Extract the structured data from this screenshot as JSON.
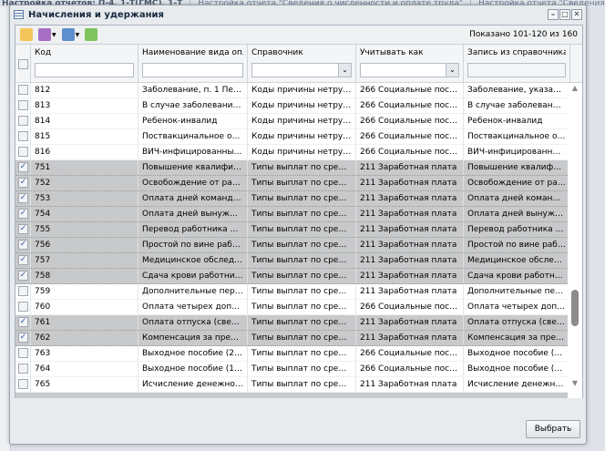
{
  "background_tabs": [
    "Настройка отчетов: П-4, 1-Т(ГМС), 1-Т",
    "Настройка отчета \"Сведения о численности и оплате труда\"",
    "Настройка отчета \"Сведения о распределении ч"
  ],
  "window": {
    "title": "Начисления и удержания",
    "page_info": "Показано 101-120 из 160",
    "select_label": "Выбрать"
  },
  "columns": [
    "Код",
    "Наименование вида опла...",
    "Справочник",
    "Учитывать как",
    "Запись из справочника"
  ],
  "rows": [
    {
      "checked": false,
      "code": "812",
      "name": "Заболевание, п. 1 Переч...",
      "ref": "Коды причины нетрудос...",
      "as": "266 Социальные пособия...",
      "rec": "Заболевание, указанное ..."
    },
    {
      "checked": false,
      "code": "813",
      "name": "В случае заболевания ре...",
      "ref": "Коды причины нетрудос...",
      "as": "266 Социальные пособия...",
      "rec": "В случае заболевания ре..."
    },
    {
      "checked": false,
      "code": "814",
      "name": "Ребенок-инвалид",
      "ref": "Коды причины нетрудос...",
      "as": "266 Социальные пособия...",
      "rec": "Ребенок-инвалид"
    },
    {
      "checked": false,
      "code": "815",
      "name": "Поствакцинальное осло...",
      "ref": "Коды причины нетрудос...",
      "as": "266 Социальные пособия...",
      "rec": "Поствакцинальное осло..."
    },
    {
      "checked": false,
      "code": "816",
      "name": "ВИЧ-инфицированный р...",
      "ref": "Коды причины нетрудос...",
      "as": "266 Социальные пособия...",
      "rec": "ВИЧ-инфицированный р..."
    },
    {
      "checked": true,
      "code": "751",
      "name": "Повышение квалификац...",
      "ref": "Типы выплат по среднем...",
      "as": "211 Заработная плата",
      "rec": "Повышение квалификац..."
    },
    {
      "checked": true,
      "code": "752",
      "name": "Освобождение от работ...",
      "ref": "Типы выплат по среднем...",
      "as": "211 Заработная плата",
      "rec": "Освобождение от работ..."
    },
    {
      "checked": true,
      "code": "753",
      "name": "Оплата дней командиров...",
      "ref": "Типы выплат по среднем...",
      "as": "211 Заработная плата",
      "rec": "Оплата дней командиров..."
    },
    {
      "checked": true,
      "code": "754",
      "name": "Оплата дней вынужденн...",
      "ref": "Типы выплат по среднем...",
      "as": "211 Заработная плата",
      "rec": "Оплата дней вынужденн..."
    },
    {
      "checked": true,
      "code": "755",
      "name": "Перевод работника на н...",
      "ref": "Типы выплат по среднем...",
      "as": "211 Заработная плата",
      "rec": "Перевод работника на н..."
    },
    {
      "checked": true,
      "code": "756",
      "name": "Простой по вине работо...",
      "ref": "Типы выплат по среднем...",
      "as": "211 Заработная плата",
      "rec": "Простой по вине работо..."
    },
    {
      "checked": true,
      "code": "757",
      "name": "Медицинское обследова...",
      "ref": "Типы выплат по среднем...",
      "as": "211 Заработная плата",
      "rec": "Медицинское обследова..."
    },
    {
      "checked": true,
      "code": "758",
      "name": "Сдача крови работникам...",
      "ref": "Типы выплат по среднем...",
      "as": "211 Заработная плата",
      "rec": "Сдача крови работникам..."
    },
    {
      "checked": false,
      "code": "759",
      "name": "Дополнительные переры...",
      "ref": "Типы выплат по среднем...",
      "as": "211 Заработная плата",
      "rec": "Дополнительные переры..."
    },
    {
      "checked": false,
      "code": "760",
      "name": "Оплата четырех дополни...",
      "ref": "Типы выплат по среднем...",
      "as": "266 Социальные пособия...",
      "rec": "Оплата четырех дополни..."
    },
    {
      "checked": true,
      "code": "761",
      "name": "Оплата отпуска (сверх е...",
      "ref": "Типы выплат по среднем...",
      "as": "211 Заработная плата",
      "rec": "Оплата отпуска (сверх е..."
    },
    {
      "checked": true,
      "code": "762",
      "name": "Компенсация за преждев...",
      "ref": "Типы выплат по среднем...",
      "as": "211 Заработная плата",
      "rec": "Компенсация за преждев..."
    },
    {
      "checked": false,
      "code": "763",
      "name": "Выходное пособие (2 не...",
      "ref": "Типы выплат по среднем...",
      "as": "266 Социальные пособия...",
      "rec": "Выходное пособие (2 не..."
    },
    {
      "checked": false,
      "code": "764",
      "name": "Выходное пособие (1 ме...",
      "ref": "Типы выплат по среднем...",
      "as": "266 Социальные пособия...",
      "rec": "Выходное пособие (1 ме..."
    },
    {
      "checked": false,
      "code": "765",
      "name": "Исчисление денежного с...",
      "ref": "Типы выплат по среднем...",
      "as": "211 Заработная плата",
      "rec": "Исчисление денежного с..."
    }
  ],
  "scroll_position_percent": 70,
  "colors": {
    "selected_row": "#c8c9cb",
    "check": "#3258a8"
  }
}
